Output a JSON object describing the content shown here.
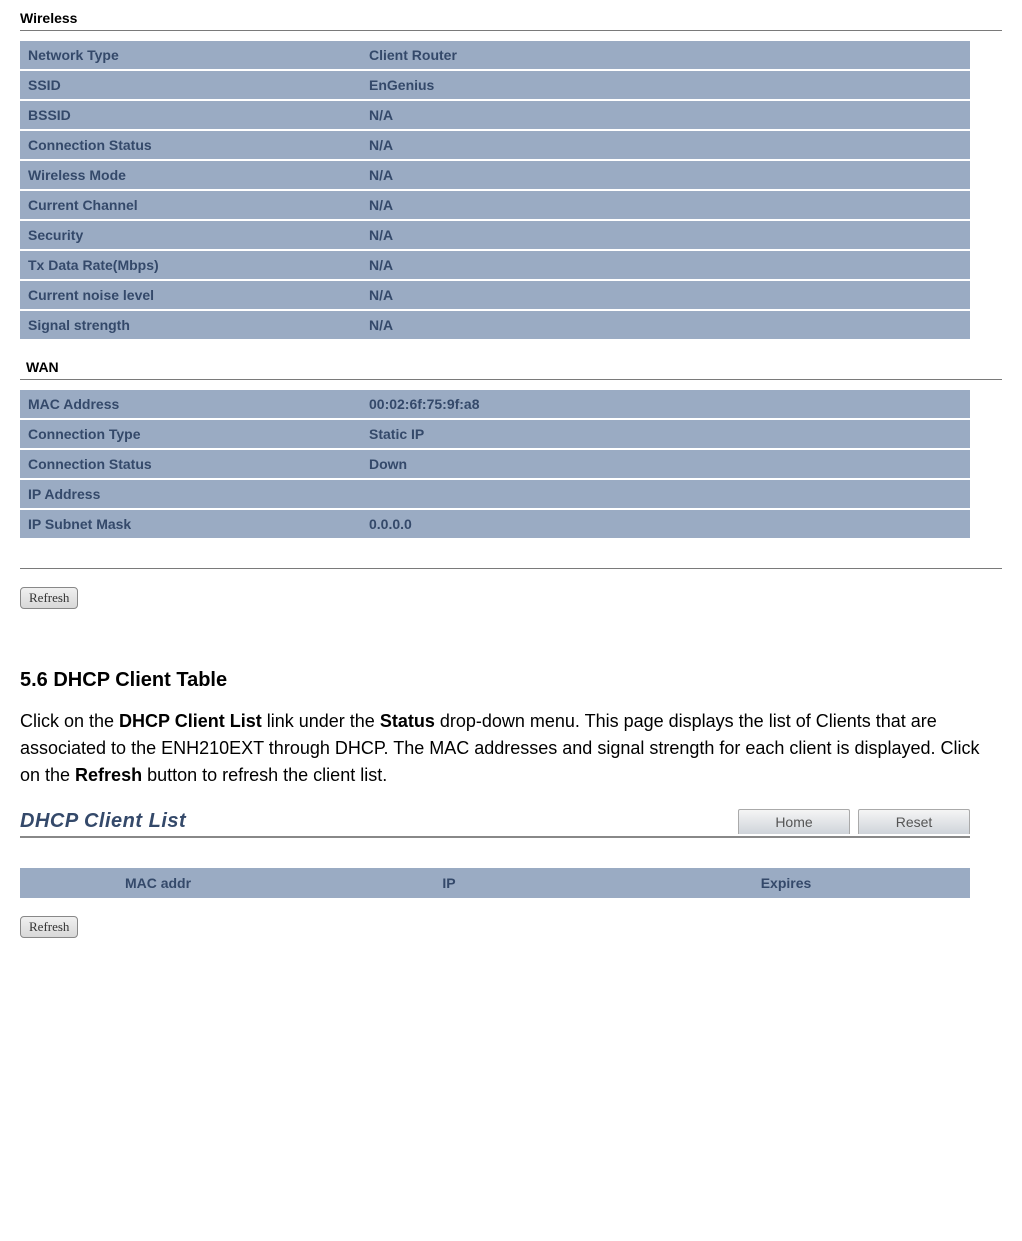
{
  "wireless": {
    "title": "Wireless",
    "rows": [
      {
        "label": "Network Type",
        "value": "Client Router"
      },
      {
        "label": "SSID",
        "value": "EnGenius"
      },
      {
        "label": "BSSID",
        "value": "N/A"
      },
      {
        "label": "Connection Status",
        "value": "N/A"
      },
      {
        "label": "Wireless Mode",
        "value": "N/A"
      },
      {
        "label": "Current Channel",
        "value": "N/A"
      },
      {
        "label": "Security",
        "value": "N/A"
      },
      {
        "label": "Tx Data Rate(Mbps)",
        "value": "N/A"
      },
      {
        "label": "Current noise level",
        "value": "N/A"
      },
      {
        "label": "Signal strength",
        "value": "N/A"
      }
    ]
  },
  "wan": {
    "title": "WAN",
    "rows": [
      {
        "label": "MAC Address",
        "value": "00:02:6f:75:9f:a8"
      },
      {
        "label": "Connection Type",
        "value": "Static IP"
      },
      {
        "label": "Connection Status",
        "value": "Down"
      },
      {
        "label": "IP Address",
        "value": ""
      },
      {
        "label": "IP Subnet Mask",
        "value": "0.0.0.0"
      }
    ]
  },
  "refresh_label": "Refresh",
  "doc": {
    "heading": "5.6 DHCP Client Table",
    "para_parts": {
      "p1": "Click on the ",
      "b1": "DHCP Client List",
      "p2": " link under the ",
      "b2": "Status",
      "p3": " drop-down menu. This page displays the list of Clients that are associated to the ENH210EXT through DHCP. The MAC addresses and signal strength for each client is displayed. Click on the ",
      "b3": "Refresh",
      "p4": " button to refresh the client list."
    }
  },
  "dhcp": {
    "title": "DHCP Client List",
    "home_label": "Home",
    "reset_label": "Reset",
    "columns": {
      "mac": "MAC addr",
      "ip": "IP",
      "expires": "Expires"
    }
  }
}
